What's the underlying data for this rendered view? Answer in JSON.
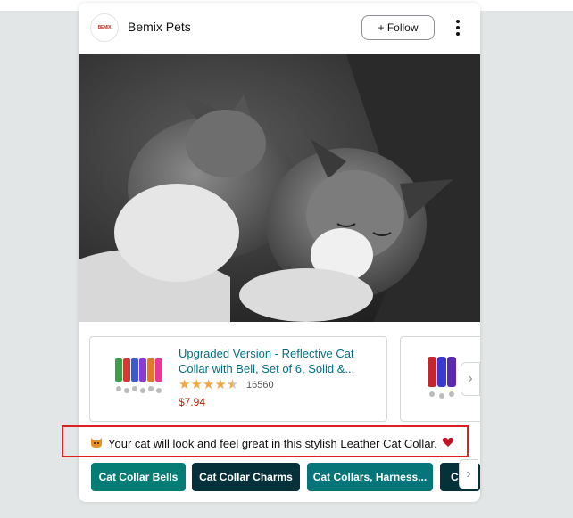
{
  "header": {
    "brand_name": "Bemix Pets",
    "logo_text": "BEMIX",
    "follow_label": "+ Follow",
    "more_icon": "more-vertical-icon"
  },
  "post": {
    "image": "two-cats-black-and-white-photo"
  },
  "products": [
    {
      "title": "Upgraded Version - Reflective Cat Collar with Bell, Set of 6, Solid &...",
      "rating": 4.5,
      "rating_count": "16560",
      "price": "$7.94"
    }
  ],
  "caption": {
    "leading_icon": "cat-face-emoji-icon",
    "text": "Your cat will look and feel great in this stylish Leather Cat Collar.",
    "trailing_icon": "heart-emoji-icon"
  },
  "chips": [
    {
      "label": "Cat Collar Bells",
      "color": "#067d74"
    },
    {
      "label": "Cat Collar Charms",
      "color": "#05313a"
    },
    {
      "label": "Cat Collars, Harness...",
      "color": "#05757a"
    },
    {
      "label": "C",
      "color": "#05313a"
    }
  ],
  "colors": {
    "link": "#007185",
    "price": "#b12704",
    "star": "#f3a847",
    "highlight_box": "#e02020"
  }
}
